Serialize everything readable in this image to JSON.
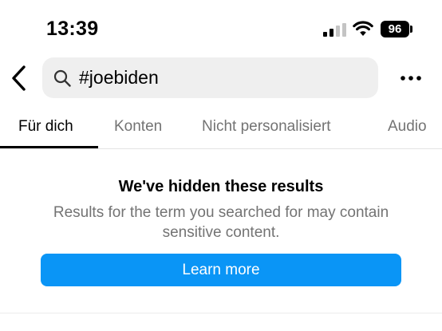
{
  "status_bar": {
    "time": "13:39",
    "battery": "96",
    "signal_icon": "cellular-signal-icon",
    "wifi_icon": "wifi-icon"
  },
  "header": {
    "back_icon": "chevron-left-icon",
    "search_icon": "search-icon",
    "search_value": "#joebiden",
    "more_icon": "more-horizontal-icon"
  },
  "tabs": [
    {
      "label": "Für dich",
      "active": true
    },
    {
      "label": "Konten",
      "active": false
    },
    {
      "label": "Nicht personalisiert",
      "active": false
    },
    {
      "label": "Audio",
      "active": false
    }
  ],
  "notice": {
    "title": "We've hidden these results",
    "body": "Results for the term you searched for may contain sensitive content.",
    "button_label": "Learn more"
  },
  "colors": {
    "accent": "#0a95f6",
    "muted_text": "#737373",
    "search_bg": "#efefef"
  }
}
